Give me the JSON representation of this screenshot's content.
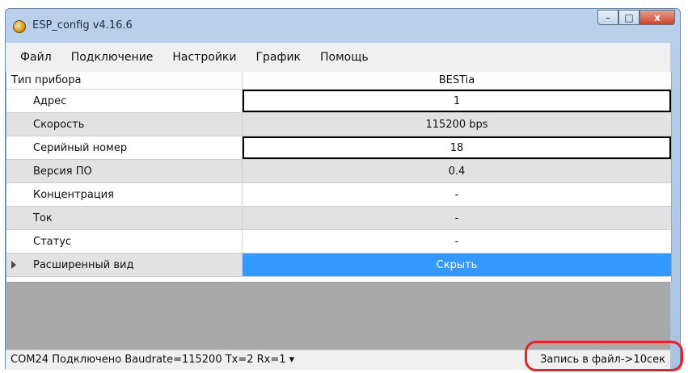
{
  "window": {
    "title": "ESP_config v4.16.6",
    "controls": [
      "–",
      "□",
      "x"
    ]
  },
  "menu": [
    "Файл",
    "Подключение",
    "Настройки",
    "График",
    "Помощь"
  ],
  "grid": {
    "rows": [
      {
        "label": "Тип прибора",
        "value": "BESTia"
      },
      {
        "label": "Адрес",
        "value": "1"
      },
      {
        "label": "Скорость",
        "value": "115200 bps"
      },
      {
        "label": "Серийный номер",
        "value": "18"
      },
      {
        "label": "Версия ПО",
        "value": "0.4"
      },
      {
        "label": "Концентрация",
        "value": "-"
      },
      {
        "label": "Ток",
        "value": "-"
      },
      {
        "label": "Статус",
        "value": "-"
      },
      {
        "label": "Расширенный вид",
        "value": "Скрыть"
      }
    ]
  },
  "statusbar": {
    "connection": "COM24 Подключено Baudrate=115200 Tx=2 Rx=1 ▾",
    "recording": "Запись в файл->10сек"
  },
  "colors": {
    "selection": "#3399ff",
    "highlight": "#e8212b"
  }
}
